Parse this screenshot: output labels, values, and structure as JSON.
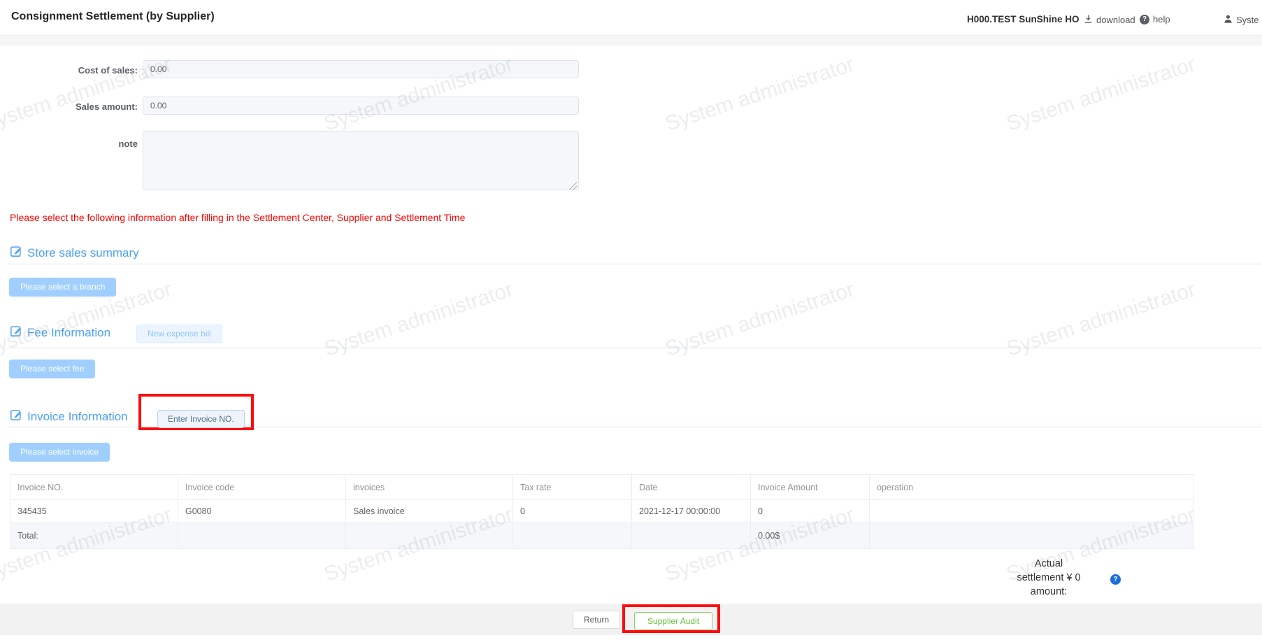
{
  "header": {
    "title": "Consignment Settlement (by Supplier)",
    "account": "H000.TEST SunShine HO",
    "download": "download",
    "help": "help",
    "user": "Syste"
  },
  "watermark": "System administrator",
  "form": {
    "cost_label": "Cost of sales:",
    "cost_value": "0.00",
    "sales_label": "Sales amount:",
    "sales_value": "0.00",
    "note_label": "note",
    "note_value": ""
  },
  "notice": "Please select the following information after filling in the Settlement Center, Supplier and Settlement Time",
  "store_section": {
    "title": "Store sales summary",
    "select_button": "Please select a branch"
  },
  "fee_section": {
    "title": "Fee Information",
    "new_button": "New expense bill",
    "select_button": "Please select fee"
  },
  "invoice_section": {
    "title": "Invoice Information",
    "enter_button": "Enter Invoice NO.",
    "select_button": "Please select invoice"
  },
  "invoice_table": {
    "headers": [
      "Invoice NO.",
      "Invoice code",
      "invoices",
      "Tax rate",
      "Date",
      "Invoice Amount",
      "operation"
    ],
    "rows": [
      [
        "345435",
        "G0080",
        "Sales invoice",
        "0",
        "2021-12-17 00:00:00",
        "0",
        ""
      ]
    ],
    "total_label": "Total:",
    "total_amount": "0.00$"
  },
  "summary": {
    "lines": [
      "Actual",
      "settlement ¥ 0",
      "amount:"
    ]
  },
  "footer": {
    "return": "Return",
    "audit": "Supplier Audit"
  },
  "colors": {
    "accent_blue": "#4da0f7",
    "disabled_button_blue": "#a0cfff",
    "annotation_red": "#fb0d0d",
    "audit_green": "#67c23a",
    "help_icon_blue": "#1a6fdf",
    "notice_red": "#fe0000"
  }
}
